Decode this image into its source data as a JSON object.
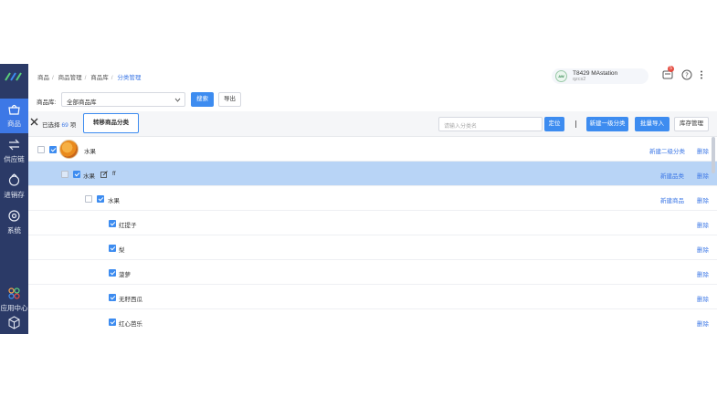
{
  "sidebar": {
    "items": [
      {
        "label": "商品",
        "icon": "basket-icon",
        "active": true
      },
      {
        "label": "供应链",
        "icon": "supply-chain-icon",
        "active": false
      },
      {
        "label": "进销存",
        "icon": "inventory-icon",
        "active": false
      },
      {
        "label": "系统",
        "icon": "gear-icon",
        "active": false
      },
      {
        "label": "应用中心",
        "icon": "app-center-icon",
        "active": false
      },
      {
        "label": "",
        "icon": "cube-icon",
        "active": false
      }
    ]
  },
  "header": {
    "breadcrumb": [
      "商品",
      "商品管理",
      "商品库",
      "分类管理"
    ],
    "user_name": "T8429 MAstation",
    "user_sub": "qzcs2",
    "notification_count": "5"
  },
  "filter": {
    "label": "商品库:",
    "selected": "全部商品库",
    "search_button": "搜索",
    "export_button": "导出"
  },
  "actionbar": {
    "selected_prefix": "已选择",
    "selected_count": "69",
    "selected_suffix": "项",
    "move_button": "转移商品分类",
    "search_placeholder": "请输入分类名",
    "locate_button": "定位",
    "new_top_button": "新建一级分类",
    "batch_import_button": "批量导入",
    "stock_manage_button": "库存管理"
  },
  "rows": [
    {
      "name": "水果",
      "action1": "新建二级分类",
      "action2": "删除"
    },
    {
      "name": "水果",
      "extra": "ff",
      "action1": "新建品类",
      "action2": "删除"
    },
    {
      "name": "水果",
      "action1": "新建商品",
      "action2": "删除"
    },
    {
      "name": "红提子",
      "action2": "删除"
    },
    {
      "name": "梨",
      "action2": "删除"
    },
    {
      "name": "菠萝",
      "action2": "删除"
    },
    {
      "name": "无籽西瓜",
      "action2": "删除"
    },
    {
      "name": "红心芭乐",
      "action2": "删除"
    }
  ],
  "colors": {
    "sidebar": "#2b3a67",
    "accent": "#3d8cf0",
    "highlight_row": "#b8d4f6"
  }
}
